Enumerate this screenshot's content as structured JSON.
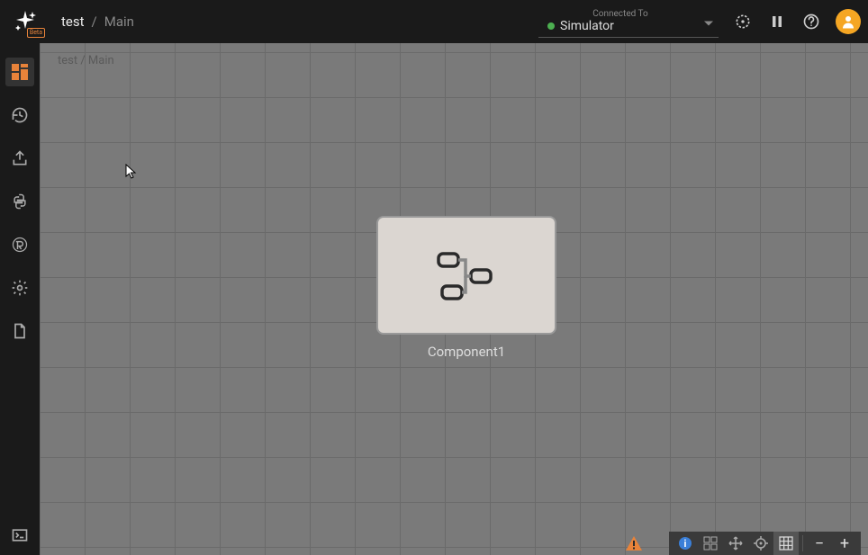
{
  "header": {
    "beta_label": "Beta",
    "breadcrumb": {
      "project": "test",
      "separator": "/",
      "page": "Main"
    },
    "connection": {
      "label": "Connected To",
      "value": "Simulator",
      "status": "connected"
    }
  },
  "sidebar": {
    "icons": [
      "dashboard",
      "history",
      "export",
      "python",
      "rust",
      "settings",
      "file"
    ]
  },
  "canvas": {
    "breadcrumb": "test / Main",
    "component_label": "Component1"
  },
  "bottom_toolbar": {
    "zoom_out": "−",
    "zoom_in": "+"
  },
  "icons": {
    "dashboard": "dashboard-icon",
    "history": "history-icon",
    "export": "export-icon",
    "python": "python-icon",
    "rust": "rust-icon",
    "settings": "gear-icon",
    "file": "file-icon",
    "target": "target-icon",
    "pause": "pause-icon",
    "help": "help-icon",
    "user": "user-icon",
    "terminal": "terminal-icon"
  }
}
